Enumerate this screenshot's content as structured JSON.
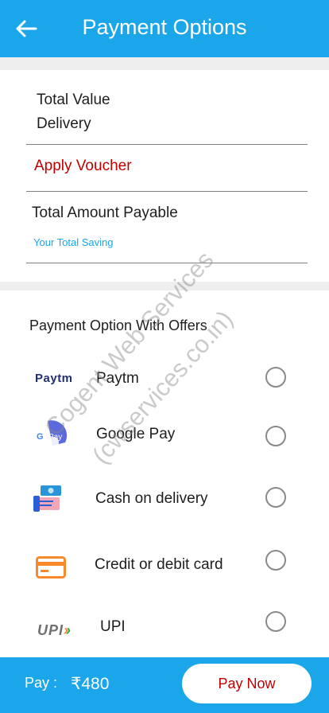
{
  "header": {
    "title": "Payment Options",
    "back_icon": "arrow-left-icon"
  },
  "summary": {
    "total_value_label": "Total Value",
    "delivery_label": "Delivery",
    "apply_voucher_label": "Apply Voucher",
    "total_payable_label": "Total Amount Payable",
    "total_saving_label": "Your Total Saving"
  },
  "payment": {
    "section_title": "Payment Option With Offers",
    "options": [
      {
        "label": "Paytm",
        "icon": "paytm-logo-icon",
        "logo_text": "Paytm"
      },
      {
        "label": "Google Pay",
        "icon": "google-pay-icon",
        "logo_text": "G Pay"
      },
      {
        "label": "Cash on delivery",
        "icon": "cash-on-delivery-icon"
      },
      {
        "label": "Credit or debit card",
        "icon": "credit-card-icon"
      },
      {
        "label": "UPI",
        "icon": "upi-logo-icon",
        "logo_text": "UPI"
      }
    ]
  },
  "watermark": {
    "line1": "Cogent Web Services",
    "line2": "(cwservices.co.in)"
  },
  "footer": {
    "pay_label": "Pay :",
    "amount": "₹480",
    "pay_now_label": "Pay Now"
  },
  "colors": {
    "primary": "#1aa6e8",
    "accent_red": "#c00000",
    "divider": "#7f7f7f"
  }
}
